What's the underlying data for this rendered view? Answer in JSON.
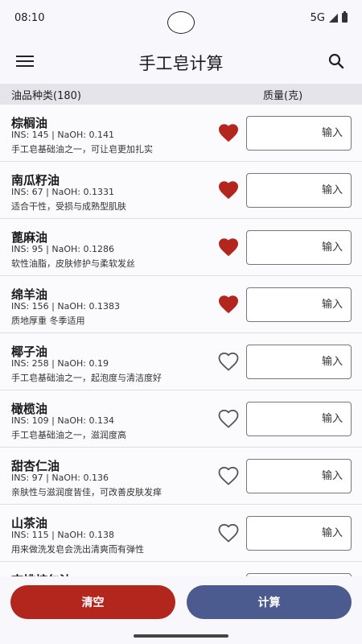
{
  "status": {
    "time": "08:10",
    "network": "5G"
  },
  "app_bar": {
    "title": "手工皂计算"
  },
  "header": {
    "col_oil": "油品种类(180)",
    "col_mass": "质量(克)"
  },
  "rows": [
    {
      "name": "棕榈油",
      "meta": "INS: 145 | NaOH: 0.141",
      "desc": "手工皂基础油之一，可让皂更加扎实",
      "favorite": true,
      "placeholder": "输入"
    },
    {
      "name": "南瓜籽油",
      "meta": "INS: 67 | NaOH: 0.1331",
      "desc": "适合干性，受损与成熟型肌肤",
      "favorite": true,
      "placeholder": "输入"
    },
    {
      "name": "蓖麻油",
      "meta": "INS: 95 | NaOH: 0.1286",
      "desc": "软性油脂，皮肤修护与柔软发丝",
      "favorite": true,
      "placeholder": "输入"
    },
    {
      "name": "绵羊油",
      "meta": "INS: 156 | NaOH: 0.1383",
      "desc": "质地厚重 冬季适用",
      "favorite": true,
      "placeholder": "输入"
    },
    {
      "name": "椰子油",
      "meta": "INS: 258 | NaOH: 0.19",
      "desc": "手工皂基础油之一，起泡度与清洁度好",
      "favorite": false,
      "placeholder": "输入"
    },
    {
      "name": "橄榄油",
      "meta": "INS: 109 | NaOH: 0.134",
      "desc": "手工皂基础油之一，滋润度高",
      "favorite": false,
      "placeholder": "输入"
    },
    {
      "name": "甜杏仁油",
      "meta": "INS: 97 | NaOH: 0.136",
      "desc": "亲肤性与滋润度皆佳，可改善皮肤发痒",
      "favorite": false,
      "placeholder": "输入"
    },
    {
      "name": "山茶油",
      "meta": "INS: 115 | NaOH: 0.138",
      "desc": "用来做洗发皂会洗出清爽而有弹性",
      "favorite": false,
      "placeholder": "输入"
    },
    {
      "name": "杏桃核仁油",
      "meta": "",
      "desc": "",
      "favorite": false,
      "placeholder": ""
    }
  ],
  "buttons": {
    "clear": "清空",
    "calculate": "计算"
  },
  "colors": {
    "accent_red": "#b3261e",
    "accent_blue": "#4b5a8f",
    "heart_filled": "#b3261e"
  },
  "icons": {
    "menu": "menu-icon",
    "search": "search-icon",
    "heart_filled": "heart-filled-icon",
    "heart_outline": "heart-outline-icon"
  }
}
